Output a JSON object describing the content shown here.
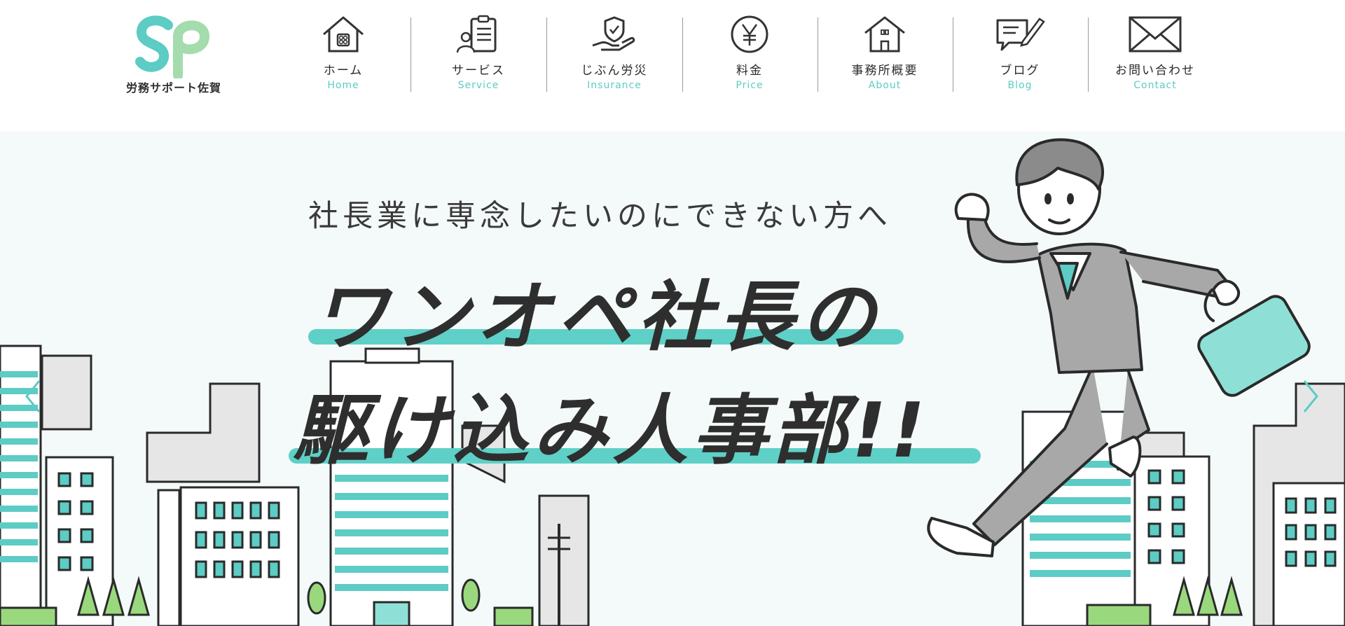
{
  "brand": {
    "name": "労務サポート佐賀",
    "colors": {
      "accent": "#5cccc4",
      "green": "#8fd47a",
      "text": "#2a2a2a"
    }
  },
  "nav": {
    "items": [
      {
        "ja": "ホーム",
        "en": "Home",
        "icon": "house-icon"
      },
      {
        "ja": "サービス",
        "en": "Service",
        "icon": "clipboard-person-icon"
      },
      {
        "ja": "じぶん労災",
        "en": "Insurance",
        "icon": "shield-hand-icon"
      },
      {
        "ja": "料金",
        "en": "Price",
        "icon": "yen-icon"
      },
      {
        "ja": "事務所概要",
        "en": "About",
        "icon": "office-building-icon"
      },
      {
        "ja": "ブログ",
        "en": "Blog",
        "icon": "chat-pen-icon"
      },
      {
        "ja": "お問い合わせ",
        "en": "Contact",
        "icon": "envelope-icon"
      }
    ]
  },
  "hero": {
    "subheading": "社長業に専念したいのにできない方へ",
    "headline_line1": "ワンオペ社長の",
    "headline_line2": "駆け込み人事部!!",
    "prev_icon": "chevron-left-icon",
    "next_icon": "chevron-right-icon"
  }
}
